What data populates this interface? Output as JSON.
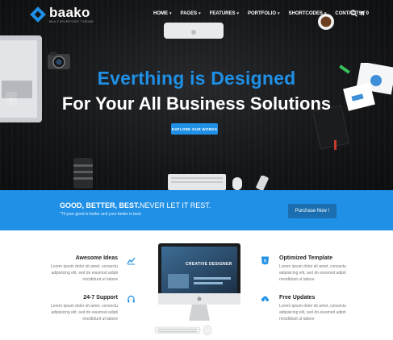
{
  "brand": {
    "name": "baako",
    "tagline": "MULTIPURPOSE THEME"
  },
  "nav": {
    "items": [
      {
        "label": "HOME",
        "caret": true
      },
      {
        "label": "PAGES",
        "caret": true
      },
      {
        "label": "FEATURES",
        "caret": true
      },
      {
        "label": "PORTFOLIO",
        "caret": true
      },
      {
        "label": "SHORTCODES",
        "caret": true
      },
      {
        "label": "CONTACTS",
        "caret": false
      }
    ],
    "cart_count": "0"
  },
  "hero": {
    "headline_1": "Everthing is Designed",
    "headline_2": "For Your All Business Solutions",
    "button": "EXPLORE OUR WORKS",
    "slider_prev": "‹"
  },
  "banner": {
    "title_bold": "GOOD, BETTER, BEST.",
    "title_rest": "NEVER LET IT REST.",
    "subtitle": "\"Til your good is better and your better is best.",
    "button": "Purchase Now !"
  },
  "features": {
    "left": [
      {
        "title": "Awesome Ideas",
        "lines": [
          "Lorem ipsum dolor sit amet, consectu",
          "adipisicing elit, sed do eiusmod adipti",
          "rincididunt ut labore"
        ],
        "icon": "chart-icon"
      },
      {
        "title": "24-7 Support",
        "lines": [
          "Lorem ipsum dolor sit amet, consectu",
          "adipisicing elit, sed do eiusmod adipti",
          "rincididunt ut labore"
        ],
        "icon": "headphones-icon"
      }
    ],
    "right": [
      {
        "title": "Optimized Template",
        "lines": [
          "Lorem ipsum dolor sit amet, consectu",
          "adipisicing elit, sed do eiusmod adipti",
          "rincididunt ut labore"
        ],
        "icon": "html5-icon"
      },
      {
        "title": "Free Updates",
        "lines": [
          "Lorem ipsum dolor sit amet, consectu",
          "adipisicing elit, sed do eiusmod adipti",
          "rincididunt ut labore"
        ],
        "icon": "cloud-download-icon"
      }
    ]
  },
  "monitor_screen": {
    "headline": "CREATIVE DESIGNER"
  },
  "colors": {
    "accent": "#1f90e6",
    "banner_button": "#1b6fb0",
    "hero_bg": "#141517"
  }
}
